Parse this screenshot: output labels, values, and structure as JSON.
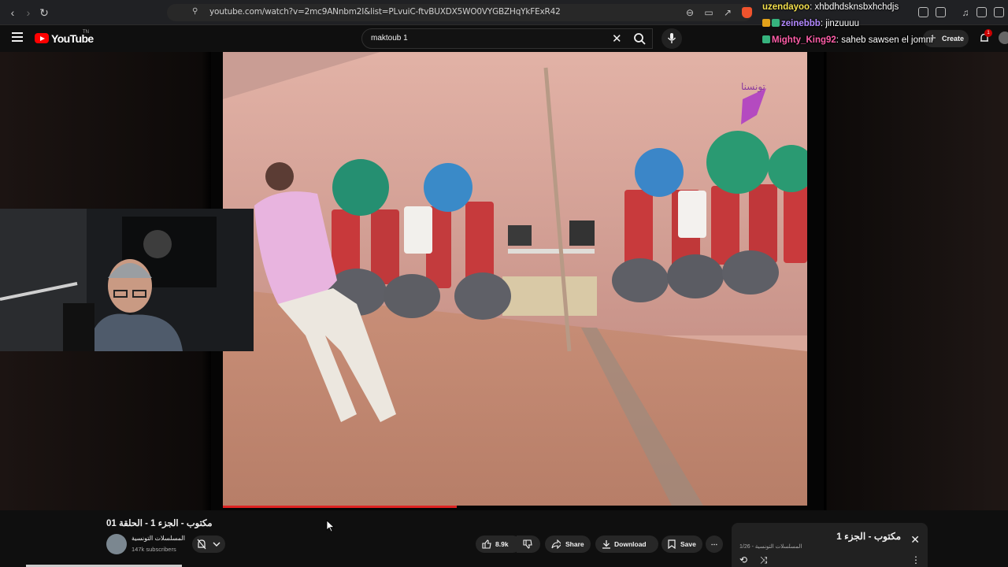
{
  "browser": {
    "url": "youtube.com/watch?v=2mc9ANnbm2I&list=PLvuiC-ftvBUXDX5WO0VYGBZHqYkFExR42"
  },
  "header": {
    "logo_text": "YouTube",
    "logo_region": "TN",
    "search_value": "maktoub 1",
    "create_label": "Create",
    "notification_count": "1"
  },
  "chat": [
    {
      "user": "uzendayoo",
      "message": "xhbdhdsknsbxhchdjs",
      "user_color": "#f4e04d"
    },
    {
      "user": "zeinebbb",
      "message": "jinzuuuu",
      "user_color": "#b388ff"
    },
    {
      "user": "Mighty_King92",
      "message": "saheb sawsen el jomni",
      "user_color": "#ff5ea8"
    }
  ],
  "video": {
    "title": "مكتوب - الجزء 1 - الحلقة 01",
    "channel_name": "المسلسلات التونسية",
    "subscribers": "147k subscribers",
    "progress": 0.4,
    "likes": "8.9k",
    "share_label": "Share",
    "download_label": "Download",
    "save_label": "Save"
  },
  "playlist": {
    "title": "مكتوب - الجزء 1",
    "meta": "1/26 - المسلسلات التونسية"
  },
  "colors": {
    "accent_red": "#ff0000",
    "background": "#0f0f0f"
  }
}
